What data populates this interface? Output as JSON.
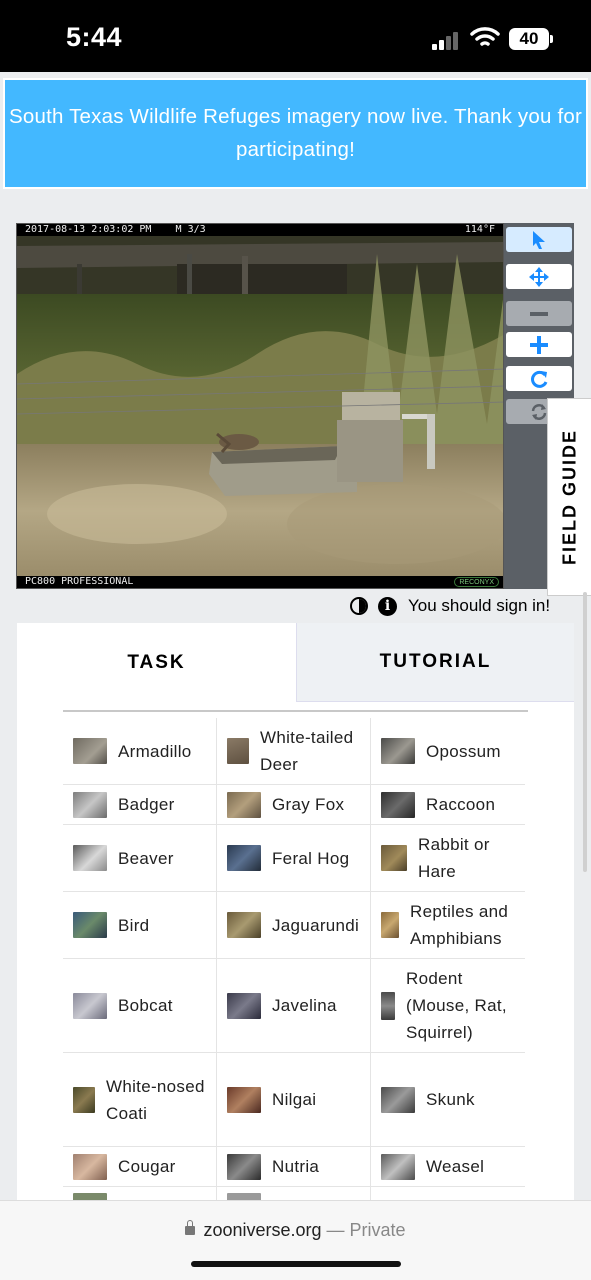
{
  "status_bar": {
    "time": "5:44",
    "battery": "40"
  },
  "announcement": "South Texas Wildlife Refuges imagery now live. Thank you for participating!",
  "camera": {
    "timestamp": "2017-08-13 2:03:02 PM",
    "frame": "M 3/3",
    "temperature": "114°F",
    "model": "PC800 PROFESSIONAL",
    "brand": "RECONYX"
  },
  "toolbar": {
    "tools": [
      "pointer-icon",
      "move-icon",
      "zoom-out-icon",
      "zoom-in-icon",
      "rotate-icon",
      "reset-icon"
    ]
  },
  "field_guide_label": "FIELD GUIDE",
  "sign_in_text": "You should sign in!",
  "tabs": {
    "task": "TASK",
    "tutorial": "TUTORIAL"
  },
  "choices": [
    [
      "Armadillo",
      "White-tailed Deer",
      "Opossum"
    ],
    [
      "Badger",
      "Gray Fox",
      "Raccoon"
    ],
    [
      "Beaver",
      "Feral Hog",
      "Rabbit or Hare"
    ],
    [
      "Bird",
      "Jaguarundi",
      "Reptiles and Amphibians"
    ],
    [
      "Bobcat",
      "Javelina",
      "Rodent (Mouse, Rat, Squirrel)"
    ],
    [
      "White-nosed Coati",
      "Nilgai",
      "Skunk"
    ],
    [
      "Cougar",
      "Nutria",
      "Weasel"
    ]
  ],
  "url_bar": {
    "domain": "zooniverse.org",
    "mode": "— Private"
  },
  "colors": {
    "banner": "#43b8ff",
    "accent": "#1a8cff"
  }
}
